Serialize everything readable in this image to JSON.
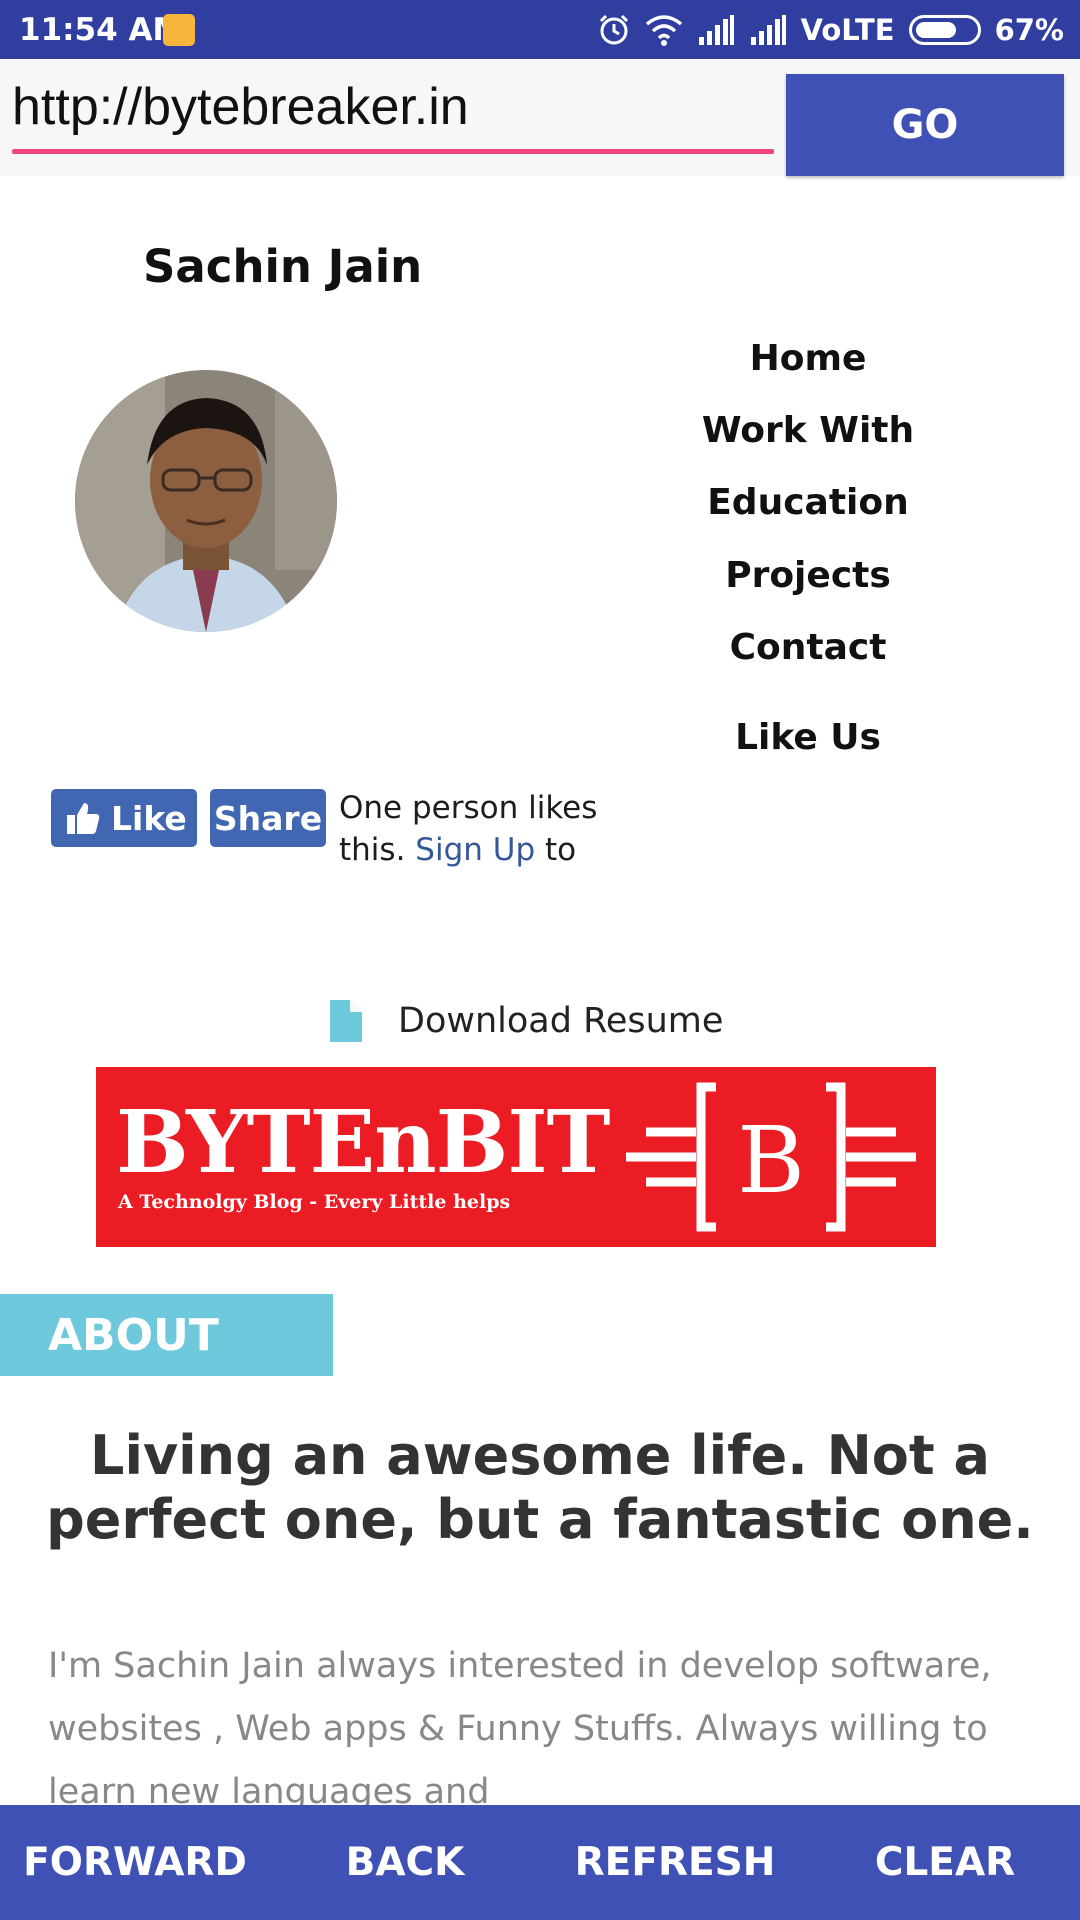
{
  "status_bar": {
    "time": "11:54 AM",
    "network": "VoLTE",
    "battery": "67%",
    "battery_level": 0.67,
    "icons": [
      "notification-icon",
      "alarm-icon",
      "wifi-icon",
      "signal-icon",
      "signal-icon",
      "battery-icon"
    ]
  },
  "browser": {
    "url": "http://bytebreaker.in",
    "go_label": "GO"
  },
  "site": {
    "title": "Sachin Jain",
    "nav": [
      "Home",
      "Work With",
      "Education",
      "Projects",
      "Contact"
    ],
    "like_us": "Like Us",
    "fb": {
      "like_label": "Like",
      "share_label": "Share",
      "text_before": "One person likes this. ",
      "link_text": "Sign Up",
      "text_after": " to see"
    },
    "download_resume": "Download Resume",
    "banner": {
      "title": "BYTEnBIT",
      "tagline": "A Technolgy Blog - Every Little helps",
      "logo_letter": "B",
      "color": "#ec1c24"
    },
    "about_label": "ABOUT",
    "headline": "Living an awesome life. Not a perfect one, but a fantastic one.",
    "about_text": "I'm Sachin Jain always interested in develop software, websites , Web apps & Funny Stuffs. Always willing to learn new languages and"
  },
  "bottom_bar": {
    "forward": "FORWARD",
    "back": "BACK",
    "refresh": "REFRESH",
    "clear": "CLEAR"
  },
  "colors": {
    "status_bar": "#303f9f",
    "primary": "#3f51b5",
    "accent": "#f0457a",
    "about_tag": "#6ec9dc",
    "facebook": "#4267b2"
  }
}
